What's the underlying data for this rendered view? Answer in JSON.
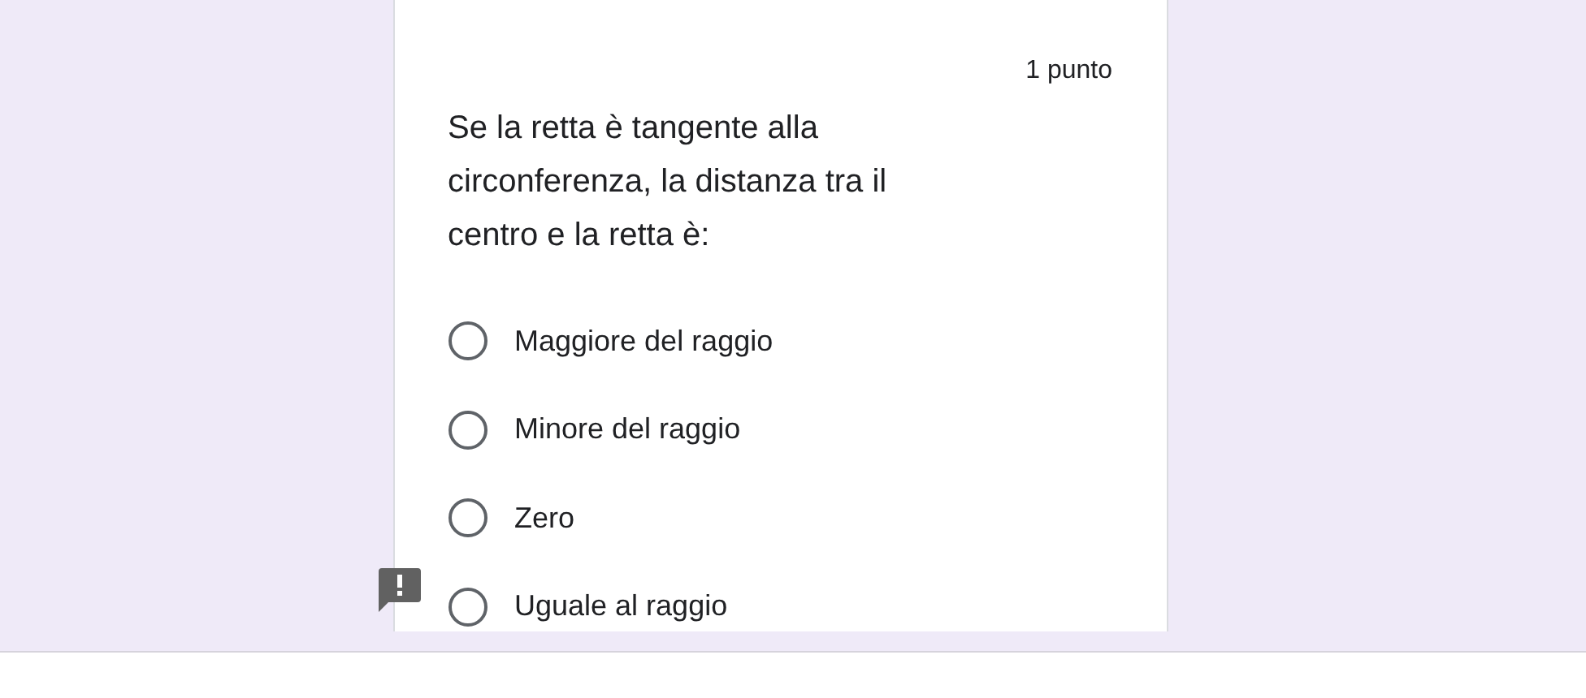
{
  "question": {
    "points": "1 punto",
    "text": "Se la retta è tangente alla circonferenza, la distanza tra il centro e la retta è:",
    "required_warning": true,
    "options": [
      {
        "label": "Maggiore del raggio",
        "selected": false
      },
      {
        "label": "Minore del raggio",
        "selected": false
      },
      {
        "label": "Zero",
        "selected": false
      },
      {
        "label": "Uguale al raggio",
        "selected": false
      }
    ]
  }
}
